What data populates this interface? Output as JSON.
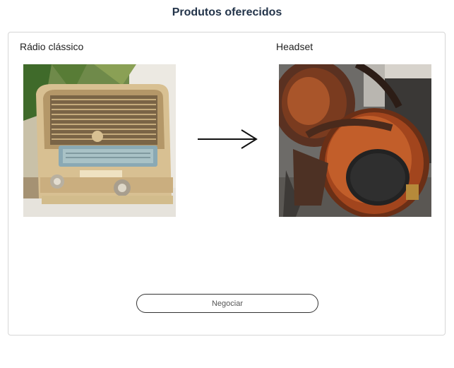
{
  "page": {
    "title": "Produtos oferecidos"
  },
  "offer": {
    "from_product": {
      "name": "Rádio clássico",
      "image_subject": "vintage-radio"
    },
    "to_product": {
      "name": "Headset",
      "image_subject": "wooden-headphones"
    },
    "arrow_icon": "arrow-right-icon"
  },
  "actions": {
    "negotiate_label": "Negociar"
  },
  "colors": {
    "title": "#23344a",
    "border": "#d6d6d6",
    "button_border": "#333333"
  }
}
